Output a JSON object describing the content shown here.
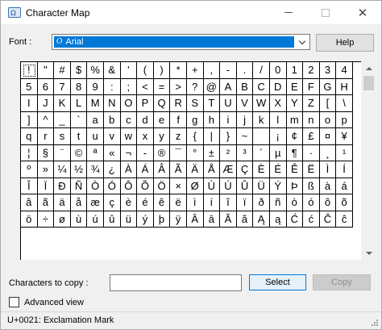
{
  "window": {
    "title": "Character Map",
    "icon": "charmap-app-icon",
    "controls": [
      "minimize-icon",
      "maximize-icon",
      "close-icon"
    ]
  },
  "font": {
    "label": "Font :",
    "selected": "Arial",
    "font_icon": "opentype-o-icon",
    "help_label": "Help"
  },
  "grid": {
    "selected_char": "!",
    "rows": [
      [
        "!",
        "\"",
        "#",
        "$",
        "%",
        "&",
        "'",
        "(",
        ")",
        "*",
        "+",
        ",",
        "-",
        ".",
        "/",
        "0",
        "1",
        "2",
        "3",
        "4"
      ],
      [
        "5",
        "6",
        "7",
        "8",
        "9",
        ":",
        ";",
        "<",
        "=",
        ">",
        "?",
        "@",
        "A",
        "B",
        "C",
        "D",
        "E",
        "F",
        "G",
        "H"
      ],
      [
        "I",
        "J",
        "K",
        "L",
        "M",
        "N",
        "O",
        "P",
        "Q",
        "R",
        "S",
        "T",
        "U",
        "V",
        "W",
        "X",
        "Y",
        "Z",
        "[",
        "\\"
      ],
      [
        "]",
        "^",
        "_",
        "`",
        "a",
        "b",
        "c",
        "d",
        "e",
        "f",
        "g",
        "h",
        "i",
        "j",
        "k",
        "l",
        "m",
        "n",
        "o",
        "p"
      ],
      [
        "q",
        "r",
        "s",
        "t",
        "u",
        "v",
        "w",
        "x",
        "y",
        "z",
        "{",
        "|",
        "}",
        "~",
        " ",
        "¡",
        "¢",
        "£",
        "¤",
        "¥"
      ],
      [
        "¦",
        "§",
        "¨",
        "©",
        "ª",
        "«",
        "¬",
        "-",
        "®",
        "¯",
        "°",
        "±",
        "²",
        "³",
        "´",
        "µ",
        "¶",
        "·",
        "¸",
        "¹"
      ],
      [
        "º",
        "»",
        "¼",
        "½",
        "¾",
        "¿",
        "À",
        "Á",
        "Â",
        "Ã",
        "Ä",
        "Å",
        "Æ",
        "Ç",
        "È",
        "É",
        "Ê",
        "Ë",
        "Ì",
        "Í"
      ],
      [
        "Î",
        "Ï",
        "Ð",
        "Ñ",
        "Ò",
        "Ó",
        "Ô",
        "Õ",
        "Ö",
        "×",
        "Ø",
        "Ù",
        "Ú",
        "Û",
        "Ü",
        "Ý",
        "Þ",
        "ß",
        "à",
        "á"
      ],
      [
        "â",
        "ã",
        "ä",
        "å",
        "æ",
        "ç",
        "è",
        "é",
        "ê",
        "ë",
        "ì",
        "í",
        "î",
        "ï",
        "ð",
        "ñ",
        "ò",
        "ó",
        "ô",
        "õ"
      ],
      [
        "ö",
        "÷",
        "ø",
        "ù",
        "ú",
        "û",
        "ü",
        "ý",
        "þ",
        "ÿ",
        "Ā",
        "ā",
        "Ă",
        "ă",
        "Ą",
        "ą",
        "Ć",
        "ć",
        "Ĉ",
        "ĉ"
      ]
    ]
  },
  "copy": {
    "label": "Characters to copy :",
    "value": "",
    "select_label": "Select",
    "copy_label": "Copy"
  },
  "advanced": {
    "label": "Advanced view",
    "checked": false
  },
  "status": {
    "text": "U+0021: Exclamation Mark"
  },
  "colors": {
    "selection": "#0078d7",
    "window_bg": "#f0f0f0"
  }
}
